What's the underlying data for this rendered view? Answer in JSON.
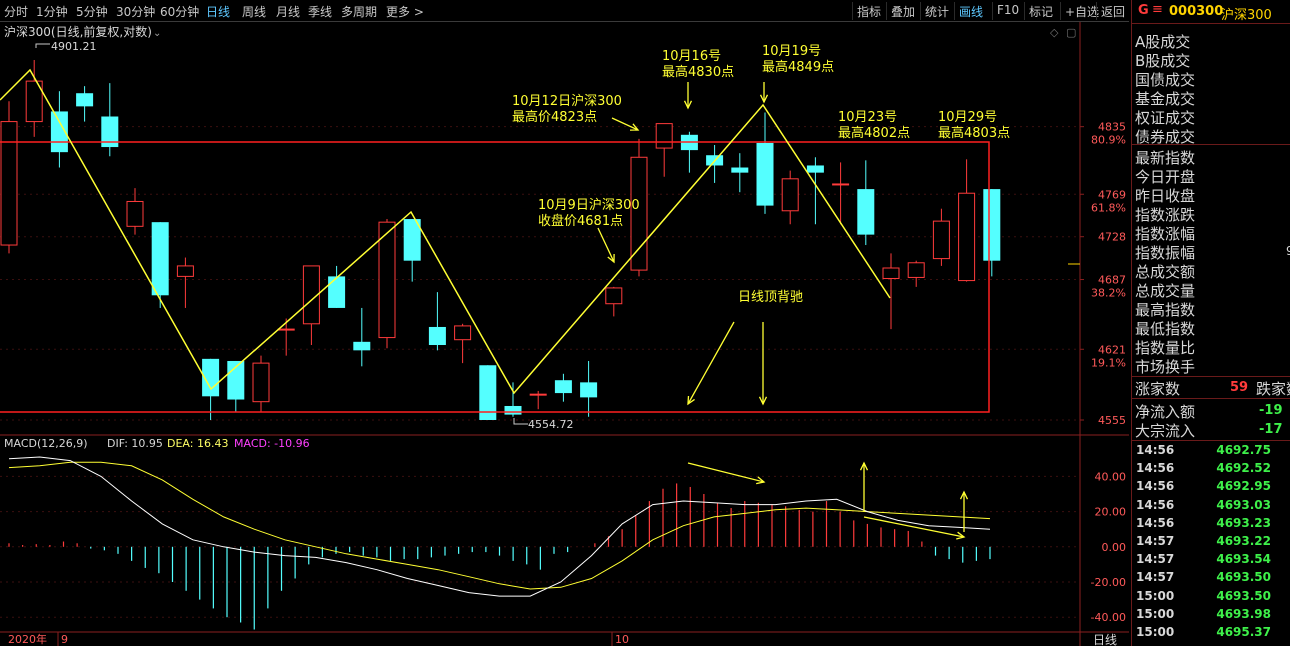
{
  "toolbar": {
    "left": [
      "分时",
      "1分钟",
      "5分钟",
      "30分钟",
      "60分钟",
      "日线",
      "周线",
      "月线",
      "季线",
      "多周期",
      "更多 >"
    ],
    "active": "日线",
    "right": [
      "指标",
      "叠加",
      "统计",
      "画线",
      "F10",
      "标记",
      "+自选",
      "返回"
    ],
    "right_active": "画线"
  },
  "main": {
    "title": "沪深300(日线,前复权,对数)",
    "high_label": "4901.21",
    "low_label": "4554.72",
    "price_axis": [
      {
        "price": "4835",
        "pct": "80.9%"
      },
      {
        "price": "4769",
        "pct": "61.8%"
      },
      {
        "price": "4728",
        "pct": ""
      },
      {
        "price": "4687",
        "pct": "38.2%"
      },
      {
        "price": "4621",
        "pct": "19.1%"
      },
      {
        "price": "4555",
        "pct": ""
      }
    ],
    "annotations": [
      {
        "id": "a1",
        "lines": [
          "10月12日沪深300",
          "最高价4823点"
        ]
      },
      {
        "id": "a2",
        "lines": [
          "10月16号",
          "最高4830点"
        ]
      },
      {
        "id": "a3",
        "lines": [
          "10月19号",
          "最高4849点"
        ]
      },
      {
        "id": "a4",
        "lines": [
          "10月23号",
          "最高4802点"
        ]
      },
      {
        "id": "a5",
        "lines": [
          "10月29号",
          "最高4803点"
        ]
      },
      {
        "id": "a6",
        "lines": [
          "10月9日沪深300",
          "收盘价4681点"
        ]
      },
      {
        "id": "a7",
        "lines": [
          "日线顶背驰"
        ]
      }
    ]
  },
  "macd": {
    "name": "MACD(12,26,9)",
    "dif": "DIF: 10.95",
    "dea": "DEA: 16.43",
    "macd": "MACD: -10.96",
    "axis": [
      "40.00",
      "20.00",
      "0.00",
      "-20.00",
      "-40.00"
    ]
  },
  "xaxis": {
    "year": "2020年",
    "m9": "9",
    "m10": "10"
  },
  "period_tab": "日线",
  "colors": {
    "up": "#ff3b3b",
    "down": "#54ffff",
    "annotation": "#ffff33",
    "macd_line": "#ff40ff"
  },
  "side": {
    "g": "G",
    "menu_icon": "≡",
    "code": "000300",
    "name": "沪深300",
    "fields1": [
      "A股成交",
      "B股成交",
      "国债成交",
      "基金成交",
      "权证成交",
      "债券成交"
    ],
    "fields2": [
      "最新指数",
      "今日开盘",
      "昨日收盘",
      "指数涨跌",
      "指数涨幅",
      "指数振幅",
      "总成交额",
      "总成交量",
      "最高指数",
      "最低指数",
      "指数量比",
      "市场换手"
    ],
    "amp_value": "9",
    "up_label": "涨家数",
    "up_value": "59",
    "down_label": "跌家数",
    "net_in_label": "净流入额",
    "net_in_value": "-19",
    "big_in_label": "大宗流入",
    "big_in_value": "-17",
    "ticks": [
      {
        "t": "14:56",
        "v": "4692.75"
      },
      {
        "t": "14:56",
        "v": "4692.52"
      },
      {
        "t": "14:56",
        "v": "4692.95"
      },
      {
        "t": "14:56",
        "v": "4693.03"
      },
      {
        "t": "14:56",
        "v": "4693.23"
      },
      {
        "t": "14:57",
        "v": "4693.22"
      },
      {
        "t": "14:57",
        "v": "4693.54"
      },
      {
        "t": "14:57",
        "v": "4693.50"
      },
      {
        "t": "15:00",
        "v": "4693.50"
      },
      {
        "t": "15:00",
        "v": "4693.98"
      },
      {
        "t": "15:00",
        "v": "4695.37"
      }
    ]
  },
  "chart_data": {
    "type": "candlestick",
    "title": "沪深300(日线,前复权,对数)",
    "candles": [
      {
        "o": 4720,
        "h": 4860,
        "l": 4712,
        "c": 4840
      },
      {
        "o": 4840,
        "h": 4901,
        "l": 4825,
        "c": 4880
      },
      {
        "o": 4850,
        "h": 4870,
        "l": 4795,
        "c": 4810
      },
      {
        "o": 4868,
        "h": 4875,
        "l": 4840,
        "c": 4855
      },
      {
        "o": 4845,
        "h": 4878,
        "l": 4806,
        "c": 4815
      },
      {
        "o": 4738,
        "h": 4775,
        "l": 4730,
        "c": 4762
      },
      {
        "o": 4742,
        "h": 4742,
        "l": 4660,
        "c": 4672
      },
      {
        "o": 4690,
        "h": 4708,
        "l": 4660,
        "c": 4700
      },
      {
        "o": 4612,
        "h": 4612,
        "l": 4555,
        "c": 4577
      },
      {
        "o": 4610,
        "h": 4610,
        "l": 4562,
        "c": 4574
      },
      {
        "o": 4572,
        "h": 4615,
        "l": 4562,
        "c": 4608
      },
      {
        "o": 4640,
        "h": 4650,
        "l": 4615,
        "c": 4640
      },
      {
        "o": 4645,
        "h": 4700,
        "l": 4625,
        "c": 4700
      },
      {
        "o": 4690,
        "h": 4700,
        "l": 4660,
        "c": 4660
      },
      {
        "o": 4628,
        "h": 4660,
        "l": 4605,
        "c": 4620
      },
      {
        "o": 4632,
        "h": 4745,
        "l": 4622,
        "c": 4742
      },
      {
        "o": 4745,
        "h": 4745,
        "l": 4685,
        "c": 4705
      },
      {
        "o": 4642,
        "h": 4675,
        "l": 4620,
        "c": 4625
      },
      {
        "o": 4630,
        "h": 4645,
        "l": 4608,
        "c": 4643
      },
      {
        "o": 4606,
        "h": 4606,
        "l": 4555,
        "c": 4555
      },
      {
        "o": 4568,
        "h": 4590,
        "l": 4558,
        "c": 4560
      },
      {
        "o": 4579,
        "h": 4582,
        "l": 4565,
        "c": 4579
      },
      {
        "o": 4592,
        "h": 4598,
        "l": 4572,
        "c": 4580
      },
      {
        "o": 4590,
        "h": 4610,
        "l": 4558,
        "c": 4576
      },
      {
        "o": 4664,
        "h": 4680,
        "l": 4652,
        "c": 4679
      },
      {
        "o": 4696,
        "h": 4823,
        "l": 4690,
        "c": 4805
      },
      {
        "o": 4814,
        "h": 4823,
        "l": 4786,
        "c": 4838
      },
      {
        "o": 4827,
        "h": 4830,
        "l": 4790,
        "c": 4812
      },
      {
        "o": 4807,
        "h": 4817,
        "l": 4780,
        "c": 4797
      },
      {
        "o": 4795,
        "h": 4809,
        "l": 4771,
        "c": 4790
      },
      {
        "o": 4819,
        "h": 4849,
        "l": 4750,
        "c": 4758
      },
      {
        "o": 4753,
        "h": 4792,
        "l": 4740,
        "c": 4784
      },
      {
        "o": 4797,
        "h": 4805,
        "l": 4740,
        "c": 4790
      },
      {
        "o": 4779,
        "h": 4800,
        "l": 4740,
        "c": 4779
      },
      {
        "o": 4774,
        "h": 4802,
        "l": 4720,
        "c": 4730
      },
      {
        "o": 4688,
        "h": 4712,
        "l": 4640,
        "c": 4698
      },
      {
        "o": 4689,
        "h": 4705,
        "l": 4680,
        "c": 4703
      },
      {
        "o": 4707,
        "h": 4755,
        "l": 4700,
        "c": 4743
      },
      {
        "o": 4686,
        "h": 4803,
        "l": 4685,
        "c": 4770
      },
      {
        "o": 4774,
        "h": 4774,
        "l": 4690,
        "c": 4705
      }
    ],
    "macd_hist": [
      2,
      1,
      1.5,
      1,
      3,
      2,
      -1,
      -2,
      -4,
      -8,
      -12,
      -15,
      -20,
      -25,
      -30,
      -35,
      -40,
      -43,
      -47,
      -35,
      -25,
      -18,
      -10,
      -6,
      -4,
      -3,
      -5,
      -6,
      -8,
      -7,
      -7,
      -6,
      -5,
      -4,
      -3,
      -3,
      -5,
      -8,
      -10,
      -13,
      -4,
      -3,
      0,
      2,
      6,
      10,
      18,
      26,
      33,
      36,
      34,
      30,
      25,
      22,
      26,
      25,
      24,
      23,
      21,
      20,
      26,
      20,
      15,
      13,
      11,
      10,
      9,
      3,
      -5,
      -7,
      -9,
      -8,
      -7
    ],
    "dif": [
      50,
      51,
      49,
      40,
      26,
      13,
      4,
      0,
      -3,
      -5,
      -6,
      -9,
      -13,
      -18,
      -22,
      -26,
      -28,
      -28,
      -20,
      -5,
      13,
      24,
      26,
      25,
      24,
      24,
      26,
      27,
      20,
      15,
      12,
      11,
      10
    ],
    "dea": [
      45,
      46,
      48,
      48,
      46,
      38,
      27,
      17,
      10,
      4,
      0,
      -4,
      -7,
      -10,
      -13,
      -17,
      -21,
      -24,
      -23,
      -18,
      -8,
      4,
      12,
      17,
      19,
      21,
      22,
      21,
      20,
      19,
      18,
      17,
      16
    ],
    "xlabels": [
      "2020年",
      "9",
      "10"
    ],
    "ylim": [
      4555,
      4901
    ],
    "macd_ylim": [
      -45,
      55
    ]
  }
}
